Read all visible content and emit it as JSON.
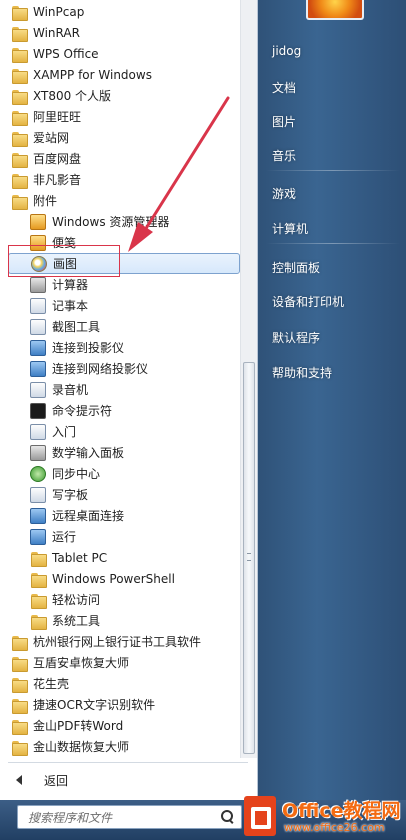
{
  "programs": [
    {
      "label": "WinPcap",
      "type": "folder",
      "level": "top"
    },
    {
      "label": "WinRAR",
      "type": "folder",
      "level": "top"
    },
    {
      "label": "WPS Office",
      "type": "folder",
      "level": "top"
    },
    {
      "label": "XAMPP for Windows",
      "type": "folder",
      "level": "top"
    },
    {
      "label": "XT800 个人版",
      "type": "folder",
      "level": "top"
    },
    {
      "label": "阿里旺旺",
      "type": "folder",
      "level": "top"
    },
    {
      "label": "爱站网",
      "type": "folder",
      "level": "top"
    },
    {
      "label": "百度网盘",
      "type": "folder",
      "level": "top"
    },
    {
      "label": "非凡影音",
      "type": "folder",
      "level": "top"
    },
    {
      "label": "附件",
      "type": "folder",
      "level": "top"
    },
    {
      "label": "Windows 资源管理器",
      "type": "app",
      "level": "sub",
      "icon": "folder-explorer-icon"
    },
    {
      "label": "便笺",
      "type": "app",
      "level": "sub",
      "icon": "sticky-notes-icon"
    },
    {
      "label": "画图",
      "type": "app",
      "level": "sub",
      "icon": "paint-icon",
      "selected": true
    },
    {
      "label": "计算器",
      "type": "app",
      "level": "sub",
      "icon": "calculator-icon"
    },
    {
      "label": "记事本",
      "type": "app",
      "level": "sub",
      "icon": "notepad-icon"
    },
    {
      "label": "截图工具",
      "type": "app",
      "level": "sub",
      "icon": "snipping-tool-icon"
    },
    {
      "label": "连接到投影仪",
      "type": "app",
      "level": "sub",
      "icon": "projector-icon"
    },
    {
      "label": "连接到网络投影仪",
      "type": "app",
      "level": "sub",
      "icon": "network-projector-icon"
    },
    {
      "label": "录音机",
      "type": "app",
      "level": "sub",
      "icon": "microphone-icon"
    },
    {
      "label": "命令提示符",
      "type": "app",
      "level": "sub",
      "icon": "command-prompt-icon"
    },
    {
      "label": "入门",
      "type": "app",
      "level": "sub",
      "icon": "getting-started-icon"
    },
    {
      "label": "数学输入面板",
      "type": "app",
      "level": "sub",
      "icon": "math-input-icon"
    },
    {
      "label": "同步中心",
      "type": "app",
      "level": "sub",
      "icon": "sync-center-icon"
    },
    {
      "label": "写字板",
      "type": "app",
      "level": "sub",
      "icon": "wordpad-icon"
    },
    {
      "label": "远程桌面连接",
      "type": "app",
      "level": "sub",
      "icon": "remote-desktop-icon"
    },
    {
      "label": "运行",
      "type": "app",
      "level": "sub",
      "icon": "run-icon"
    },
    {
      "label": "Tablet PC",
      "type": "folder",
      "level": "sub"
    },
    {
      "label": "Windows PowerShell",
      "type": "folder",
      "level": "sub"
    },
    {
      "label": "轻松访问",
      "type": "folder",
      "level": "sub"
    },
    {
      "label": "系统工具",
      "type": "folder",
      "level": "sub"
    },
    {
      "label": "杭州银行网上银行证书工具软件",
      "type": "folder",
      "level": "top"
    },
    {
      "label": "互盾安卓恢复大师",
      "type": "folder",
      "level": "top"
    },
    {
      "label": "花生壳",
      "type": "folder",
      "level": "top"
    },
    {
      "label": "捷速OCR文字识别软件",
      "type": "folder",
      "level": "top"
    },
    {
      "label": "金山PDF转Word",
      "type": "folder",
      "level": "top"
    },
    {
      "label": "金山数据恢复大师",
      "type": "folder",
      "level": "top"
    }
  ],
  "back_label": "返回",
  "search_placeholder": "搜索程序和文件",
  "right_panel": {
    "user": "jidog",
    "items": [
      "文档",
      "图片",
      "音乐",
      "游戏",
      "计算机",
      "控制面板",
      "设备和打印机",
      "默认程序",
      "帮助和支持"
    ]
  },
  "watermark": {
    "brand": "Office教程网",
    "url": "www.office26.com"
  },
  "colors": {
    "selection": "#d6e8fb",
    "annotation": "#d9354a",
    "watermark": "#f46b12"
  }
}
